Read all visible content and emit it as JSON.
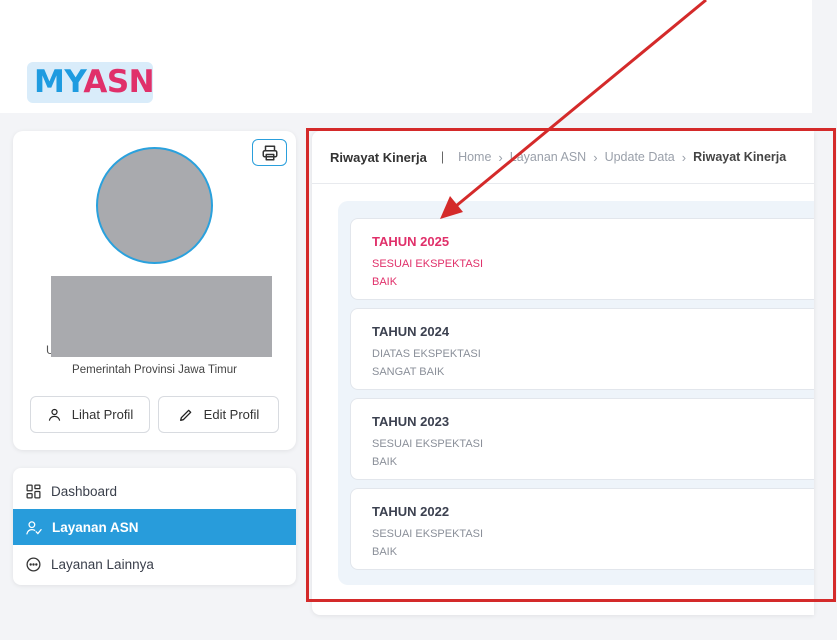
{
  "logo": {
    "part1": "MY",
    "part2": "ASN"
  },
  "colors": {
    "brand_blue": "#1e9be0",
    "brand_pink": "#e0306a",
    "active_nav": "#289cdb",
    "annotation_red": "#d42a2a"
  },
  "profile": {
    "name_partial": "U",
    "organization": "Pemerintah Provinsi Jawa Timur",
    "view_profile_label": "Lihat Profil",
    "edit_profile_label": "Edit Profil",
    "print_icon": "printer-icon"
  },
  "nav": {
    "items": [
      {
        "label": "Dashboard",
        "icon": "grid-icon",
        "active": false
      },
      {
        "label": "Layanan ASN",
        "icon": "user-check-icon",
        "active": true
      },
      {
        "label": "Layanan Lainnya",
        "icon": "more-circle-icon",
        "active": false
      }
    ]
  },
  "header": {
    "title": "Riwayat Kinerja",
    "breadcrumb": [
      "Home",
      "Layanan ASN",
      "Update Data",
      "Riwayat Kinerja"
    ]
  },
  "records": [
    {
      "year": "TAHUN 2025",
      "line1": "SESUAI EKSPEKTASI",
      "line2": "BAIK"
    },
    {
      "year": "TAHUN 2024",
      "line1": "DIATAS EKSPEKTASI",
      "line2": "SANGAT BAIK"
    },
    {
      "year": "TAHUN 2023",
      "line1": "SESUAI EKSPEKTASI",
      "line2": "BAIK"
    },
    {
      "year": "TAHUN 2022",
      "line1": "SESUAI EKSPEKTASI",
      "line2": "BAIK"
    }
  ]
}
